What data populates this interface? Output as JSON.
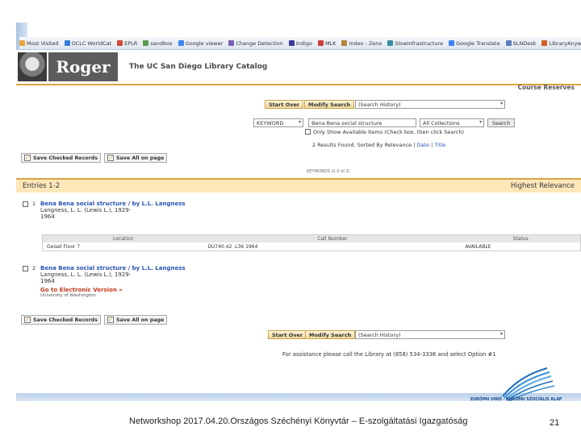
{
  "bookmarks": [
    {
      "label": "Most Visited",
      "color": "#e8a33c"
    },
    {
      "label": "OCLC WorldCat",
      "color": "#3b7dd8"
    },
    {
      "label": "EPLR",
      "color": "#d04a3a"
    },
    {
      "label": "sandbox",
      "color": "#5c9c4f"
    },
    {
      "label": "Google viewer",
      "color": "#4285f4"
    },
    {
      "label": "Change Detection",
      "color": "#7a5fb5"
    },
    {
      "label": "Indigo",
      "color": "#3b3b9a"
    },
    {
      "label": "MLK",
      "color": "#c84141"
    },
    {
      "label": "Index - Zeno",
      "color": "#b5823a"
    },
    {
      "label": "SlowInfrastructure",
      "color": "#3c8ea0"
    },
    {
      "label": "Google Translate",
      "color": "#4285f4"
    },
    {
      "label": "SLNDesk",
      "color": "#5a7fb8"
    },
    {
      "label": "LibraryAnywhere",
      "color": "#d25f2b"
    }
  ],
  "header": {
    "brand": "Roger",
    "catalog_title": "The UC San Diego Library Catalog",
    "course_reserves": "Course Reserves"
  },
  "search": {
    "start_over": "Start Over",
    "modify_search": "Modify Search",
    "history_select": "(Search History)",
    "field_select": "KEYWORD",
    "query": "Bena Bena social structure",
    "collection_select": "All Collections",
    "search_button": "Search",
    "only_available": "Only Show Available Items (Check box, then click Search)",
    "results_text": "2 Results Found. Sorted By Relevance",
    "sort_date": "Date",
    "sort_title": "Title",
    "keywords_note": "KEYWORDS (1-2 of 2)"
  },
  "actions": {
    "save_checked": "Save Checked Records",
    "save_all": "Save All on page"
  },
  "entries": {
    "label": "Entries 1-2",
    "relevance": "Highest Relevance"
  },
  "records": [
    {
      "num": "1",
      "title": "Bena Bena social structure / by L.L. Langness",
      "author": "Langness, L. L. (Lewis L.), 1929-",
      "year": "1964"
    },
    {
      "num": "2",
      "title": "Bena Bena social structure / by L.L. Langness",
      "author": "Langness, L. L. (Lewis L.), 1929-",
      "year": "1964",
      "electronic": "Go to Electronic Version",
      "extra": "University of Washington"
    }
  ],
  "holdings": {
    "headers": [
      "Location",
      "Call Number",
      "Status"
    ],
    "row": [
      "Geisel Floor 7",
      "DU740.42 .L36 1964",
      "AVAILABLE"
    ]
  },
  "assist": "For assistance please call the Library at (858) 534-3336 and select Option #1",
  "logo_text": "EURÓPAI UNIÓ · EURÓPAI SZOCIÁLIS ALAP",
  "footer": "Networkshop 2017.04.20.Országos Széchényi Könyvtár – E-szolgáltatási Igazgatóság",
  "page_number": "21"
}
